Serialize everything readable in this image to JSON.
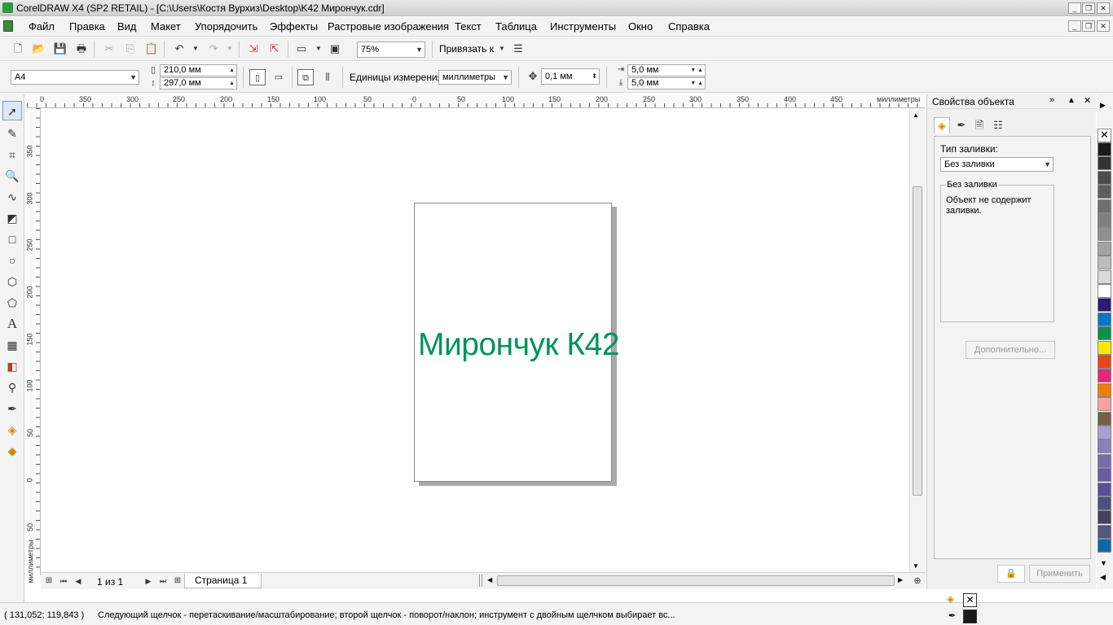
{
  "window": {
    "title": "CorelDRAW X4 (SP2 RETAIL) - [C:\\Users\\Костя Вурхиз\\Desktop\\K42 Мирончук.cdr]",
    "minimize": "_",
    "restore": "❐",
    "close": "✕"
  },
  "menu": [
    "Файл",
    "Правка",
    "Вид",
    "Макет",
    "Упорядочить",
    "Эффекты",
    "Растровые изображения",
    "Текст",
    "Таблица",
    "Инструменты",
    "Окно",
    "Справка"
  ],
  "toolbar1": {
    "zoom_value": "75%",
    "snap_label": "Привязать к"
  },
  "toolbar2": {
    "paper_size": "A4",
    "width": "210,0 мм",
    "height": "297,0 мм",
    "units_label": "Единицы измерения:",
    "units_value": "миллиметры",
    "nudge": "0,1 мм",
    "dup_x": "5,0 мм",
    "dup_y": "5,0 мм"
  },
  "ruler": {
    "h_ticks": [
      "0",
      "350",
      "300",
      "250",
      "200",
      "150",
      "100",
      "50",
      "0",
      "50",
      "100",
      "150",
      "200",
      "250",
      "300",
      "350",
      "400",
      "450"
    ],
    "h_units": "миллиметры",
    "v_ticks": [
      "350",
      "300",
      "250",
      "200",
      "150",
      "100",
      "50",
      "0",
      "50"
    ],
    "v_units": "миллиметры"
  },
  "document": {
    "text": "Мирончук К42",
    "text_color": "#00935a"
  },
  "pages": {
    "counter": "1 из 1",
    "tab": "Страница 1"
  },
  "docker": {
    "title": "Свойства объекта",
    "fill_type_label": "Тип заливки:",
    "fill_type_value": "Без заливки",
    "group_title": "Без заливки",
    "group_desc": "Объект не содержит заливки.",
    "more_button": "Дополнительно...",
    "apply_button": "Применить"
  },
  "palette": [
    "#1a1a1a",
    "#333333",
    "#4d4d4d",
    "#5e5e5e",
    "#6f6f6f",
    "#808080",
    "#919191",
    "#a3a3a3",
    "#bdbdbd",
    "#d9d9d9",
    "#ffffff",
    "#2e1a6e",
    "#0077c8",
    "#00934a",
    "#ffe800",
    "#e8421e",
    "#e8277a",
    "#f07d00",
    "#f4a3a0",
    "#7a5c47",
    "#aa9fd0",
    "#8c7fbe",
    "#7b6bb0",
    "#6a5ca3",
    "#5c4e96",
    "#4e4f80",
    "#45415e",
    "#52577f",
    "#0c6aa8"
  ],
  "status": {
    "coords": "( 131,052; 119,843 )",
    "message": "Следующий щелчок - перетаскивание/масштабирование; второй щелчок - поворот/наклон; инструмент с двойным щелчком выбирает вс..."
  }
}
